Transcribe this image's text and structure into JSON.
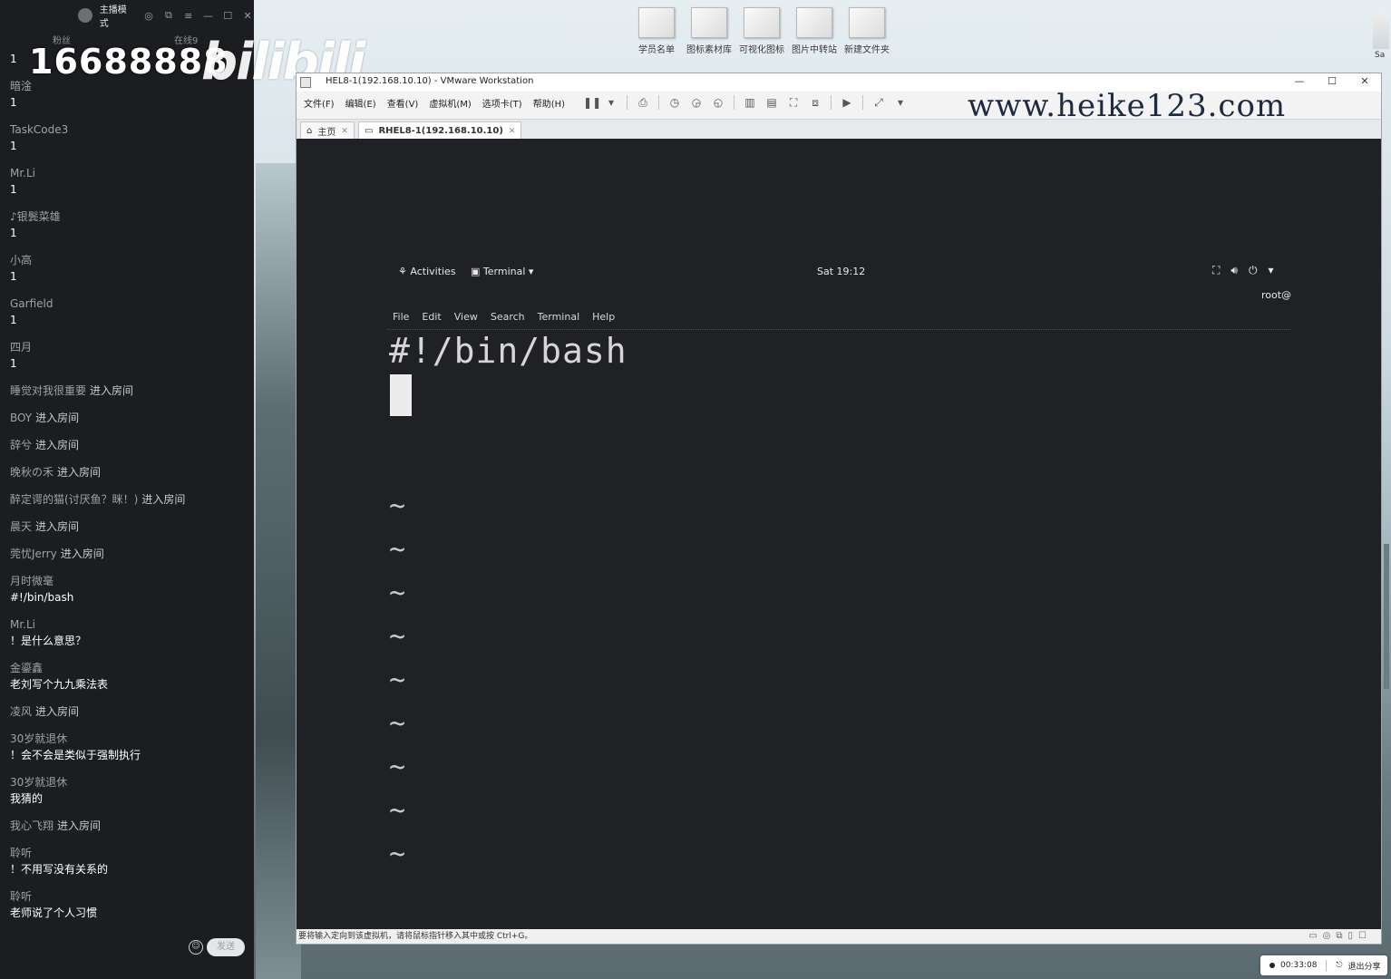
{
  "desktop": {
    "icons": [
      "学员名单",
      "图标素材库",
      "可视化图标",
      "图片中转站",
      "新建文件夹"
    ],
    "right_edge_label": "Sa"
  },
  "overlay": {
    "number": "16688888",
    "logo": "bilibili"
  },
  "chat": {
    "header": {
      "mode_label": "主播模式",
      "fans_label": "粉丝",
      "online_label": "在线9"
    },
    "messages": [
      {
        "type": "msg",
        "name": "",
        "text": "1"
      },
      {
        "type": "msg",
        "name": "暗淦",
        "text": "1"
      },
      {
        "type": "msg",
        "name": "TaskCode3",
        "text": "1"
      },
      {
        "type": "msg",
        "name": "Mr.Li",
        "text": "1"
      },
      {
        "type": "msg",
        "name": "♪银鬓菜雄",
        "text": "1"
      },
      {
        "type": "msg",
        "name": "小高",
        "text": "1"
      },
      {
        "type": "msg",
        "name": "Garfield",
        "text": "1"
      },
      {
        "type": "msg",
        "name": "四月",
        "text": "1"
      }
    ],
    "events": [
      {
        "who": "睡觉对我很重要",
        "action": "进入房间"
      },
      {
        "who": "BOY",
        "action": "进入房间"
      },
      {
        "who": "辞兮",
        "action": "进入房间"
      },
      {
        "who": "晚秋の禾",
        "action": "进入房间"
      },
      {
        "who": "醉定谔的猫(讨厌鱼？眯！)",
        "action": "进入房间"
      },
      {
        "who": "晨天",
        "action": "进入房间"
      },
      {
        "who": "莞忧Jerry",
        "action": "进入房间"
      }
    ],
    "messages2": [
      {
        "type": "msg",
        "name": "月时微毫",
        "text": "#!/bin/bash"
      },
      {
        "type": "msg",
        "name": "Mr.Li",
        "text": "！是什么意思？"
      },
      {
        "type": "msg",
        "name": "金鎏鑫",
        "text": "老刘写个九九乘法表"
      }
    ],
    "event2": {
      "who": "凌风",
      "action": "进入房间"
    },
    "messages3": [
      {
        "type": "msg",
        "name": "30岁就退休",
        "text": "！会不会是类似于强制执行"
      },
      {
        "type": "msg",
        "name": "30岁就退休",
        "text": "我猜的"
      }
    ],
    "event3": {
      "who": "我心飞翔",
      "action": "进入房间"
    },
    "messages4": [
      {
        "type": "msg",
        "name": "聆听",
        "text": "！不用写没有关系的"
      },
      {
        "type": "msg",
        "name": "聆听",
        "text": "老师说了个人习惯"
      }
    ],
    "send_label": "发送",
    "emoji_icon": "smiley-icon"
  },
  "vmware": {
    "title": "HEL8-1(192.168.10.10) - VMware Workstation",
    "menu": [
      "文件(F)",
      "编辑(E)",
      "查看(V)",
      "虚拟机(M)",
      "选项卡(T)",
      "帮助(H)"
    ],
    "watermark": "www.heike123.com",
    "tabs": [
      {
        "label": "主页"
      },
      {
        "label": "RHEL8-1(192.168.10.10)"
      }
    ],
    "status_text": "要将输入定向到该虚拟机，请将鼠标指针移入其中或按 Ctrl+G。"
  },
  "guest": {
    "activities": "Activities",
    "terminal_menu": "Terminal",
    "clock": "Sat 19:12",
    "user": "root@",
    "terminal_menus": [
      "File",
      "Edit",
      "View",
      "Search",
      "Terminal",
      "Help"
    ],
    "shebang": "#!/bin/bash",
    "tilde": "~"
  },
  "share": {
    "timer": "00:33:08",
    "exit_label": "退出分享"
  }
}
